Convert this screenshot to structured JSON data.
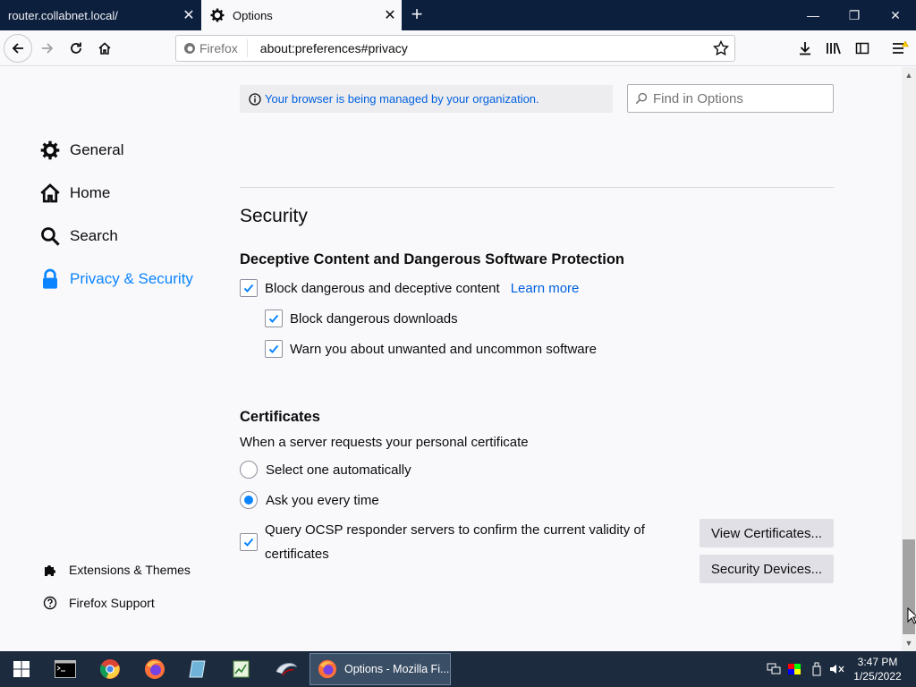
{
  "tabs": [
    {
      "title": "router.collabnet.local/",
      "active": false
    },
    {
      "title": "Options",
      "active": true
    }
  ],
  "window_controls": {
    "minimize": "—",
    "restore": "❐",
    "close": "✕"
  },
  "urlbar": {
    "identity_label": "Firefox",
    "url": "about:preferences#privacy"
  },
  "sidebar": {
    "items": [
      {
        "label": "General",
        "icon": "gear-icon"
      },
      {
        "label": "Home",
        "icon": "home-icon"
      },
      {
        "label": "Search",
        "icon": "search-icon"
      },
      {
        "label": "Privacy & Security",
        "icon": "lock-icon",
        "selected": true
      }
    ],
    "footer": [
      {
        "label": "Extensions & Themes",
        "icon": "puzzle-icon"
      },
      {
        "label": "Firefox Support",
        "icon": "help-icon"
      }
    ]
  },
  "managed_notice": "Your browser is being managed by your organization.",
  "find": {
    "placeholder": "Find in Options"
  },
  "section_title": "Security",
  "deceptive": {
    "heading": "Deceptive Content and Dangerous Software Protection",
    "block_content": {
      "label": "Block dangerous and deceptive content",
      "checked": true
    },
    "learn_more": "Learn more",
    "block_downloads": {
      "label": "Block dangerous downloads",
      "checked": true
    },
    "warn_software": {
      "label": "Warn you about unwanted and uncommon software",
      "checked": true
    }
  },
  "certificates": {
    "heading": "Certificates",
    "description": "When a server requests your personal certificate",
    "select_auto": {
      "label": "Select one automatically",
      "selected": false
    },
    "ask_every": {
      "label": "Ask you every time",
      "selected": true
    },
    "ocsp_line1": "Query OCSP responder servers to confirm the current validity of",
    "ocsp_line2": "certificates",
    "ocsp_checked": true,
    "view_certificates": "View Certificates...",
    "security_devices": "Security Devices..."
  },
  "taskbar": {
    "active_window": "Options - Mozilla Fi...",
    "time": "3:47 PM",
    "date": "1/25/2022"
  },
  "colors": {
    "accent": "#0a84ff",
    "link": "#0060df",
    "tabstrip": "#0c1f3d",
    "taskbar": "#1c2b3e"
  }
}
